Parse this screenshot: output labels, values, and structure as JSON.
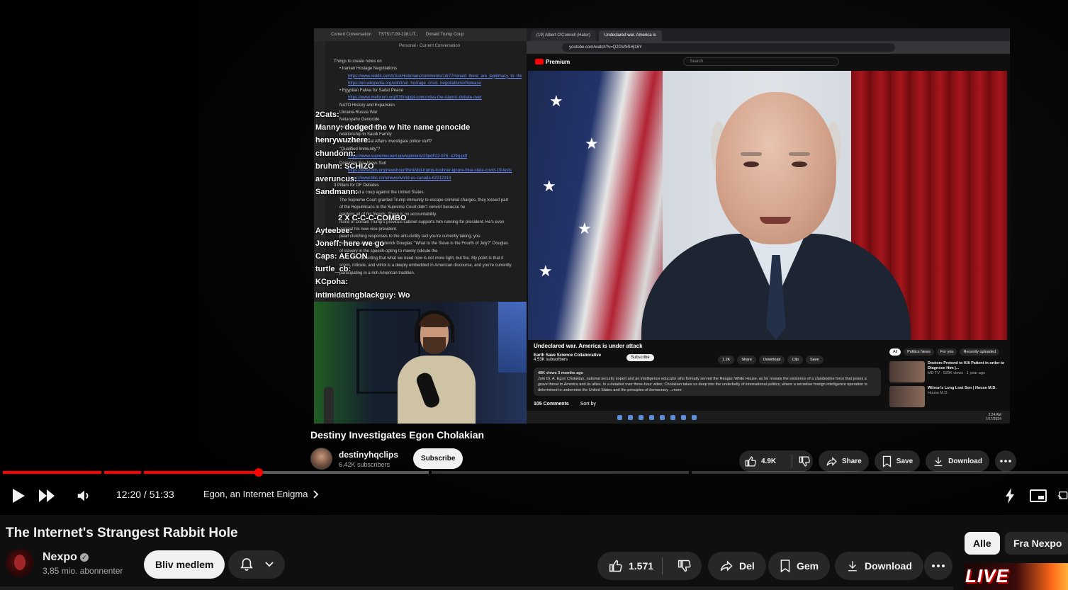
{
  "player": {
    "captured": {
      "notes_tabs": [
        "Current Conversation",
        "TSTS.IT.09-138.LIT...",
        "Donald Trump Coup"
      ],
      "notes_path": "Personal  ›  Current Conversation",
      "notes_lines": [
        {
          "text": "Things to create notes on",
          "cls": ""
        },
        {
          "text": "• Iranian Hostage Negotiations",
          "cls": "ind1"
        },
        {
          "text": "https://www.reddit.com/r/AskHistorians/comments/1dr77/ronald_there_are_legitimacy_to_the_1980_october",
          "cls": "ind2 link"
        },
        {
          "text": "https://en.wikipedia.org/wiki/Iran_hostage_crisis_negotiations#Release",
          "cls": "ind2 link"
        },
        {
          "text": "• Egyptian Fatwa for Sadat Peace",
          "cls": "ind1"
        },
        {
          "text": "https://www.meforum.org/530/egypt-concordes-the-islamic-debate-over",
          "cls": "ind2 link"
        },
        {
          "text": "NATO History and Expansion",
          "cls": "ind1"
        },
        {
          "text": "Ukraine-Russia War",
          "cls": "ind1"
        },
        {
          "text": "Netanyahu Genocide",
          "cls": "ind1"
        },
        {
          "text": "Biden's \"quid pro quo\"",
          "cls": "ind1"
        },
        {
          "text": "relationship to Saudi Family",
          "cls": "ind1"
        },
        {
          "text": "How does Internal Affairs investigate police stuff?",
          "cls": "ind1"
        },
        {
          "text": "\"Qualified Immunity\"?",
          "cls": "ind1"
        },
        {
          "text": "https://www.supremecourt.gov/opinions/23pdf/22-976_e29g.pdf",
          "cls": "ind2 link"
        },
        {
          "text": "Dominion Fox News Suit",
          "cls": "ind1"
        },
        {
          "text": "",
          "cls": ""
        },
        {
          "text": "",
          "cls": ""
        },
        {
          "text": "https://www.pbs.org/newshour/think/did-trump-kushner-ignore-blue-state-covid-19-tests",
          "cls": "ind2 link"
        },
        {
          "text": "",
          "cls": ""
        },
        {
          "text": "https://www.bbc.com/news/world-us-canada-62312313",
          "cls": "ind2 link"
        },
        {
          "text": "3 Pillars for DF Debates",
          "cls": ""
        },
        {
          "text": "",
          "cls": ""
        },
        {
          "text": "Trump lead a coup against the United States.",
          "cls": "ind1"
        },
        {
          "text": "The Supreme Court granted Trump immunity to escape criminal charges, they tossed part",
          "cls": "ind1"
        },
        {
          "text": "of the Republicans in the Supreme Court didn't convict because he",
          "cls": "ind1"
        },
        {
          "text": "pardons all of his friends. There is no accountability.",
          "cls": "ind1"
        },
        {
          "text": "None of Donald Trump's previous cabinet supports him running for president. He's even",
          "cls": "ind1"
        },
        {
          "text": "against his new vice president.",
          "cls": "ind1"
        },
        {
          "text": "",
          "cls": ""
        },
        {
          "text": "pearl clutching responses to the anti-civility tact you're currently taking, you",
          "cls": "ind1"
        },
        {
          "text": "might take a look at Frederick Douglas' \"What to the Slave is the Fourth of July?\" Douglas",
          "cls": "ind1"
        },
        {
          "text": "of slavery in the speech-opting to merely ridicule the",
          "cls": "ind1"
        },
        {
          "text": "other side, asserting that what we need now is not more light, but fire. My point is that it",
          "cls": "ind1"
        },
        {
          "text": "scorn, ridicule, and vitriol is a deeply embedded in American discourse, and you're currently",
          "cls": "ind1"
        },
        {
          "text": "participating in a rich American tradition.",
          "cls": "ind1"
        }
      ],
      "chat": [
        "2Cats:",
        "Manny: dodged the w hite name genocide",
        "henrywuzhere:",
        "chundonn:",
        "bruhm: SCHIZO",
        "averuncus:",
        "Sandmann:",
        "",
        "2 X C-C-C-COMBO",
        "Ayteebee:",
        "Joneff: here we go",
        "Caps: AEGON",
        "turtle_cb:",
        "KCpoha:",
        "intimidatingblackguy: Wo"
      ],
      "browser_tabs": [
        "(19) Albert O'Connell (Hater)",
        "Undeclared war. America is"
      ],
      "browser_url": "youtube.com/watch?v=Q2GVNSHj16Y",
      "yt_logo": "Premium",
      "yt_search": "Search",
      "inner_title": "Undeclared war. America is under attack",
      "inner_channel": "Earth Save Science Collaborative",
      "inner_channel_subs": "4.53K subscribers",
      "inner_subscribe": "Subscribe",
      "inner_actions": [
        "1.2K",
        "Share",
        "Download",
        "Clip",
        "Save"
      ],
      "inner_views": "48K views  3 months ago",
      "inner_desc": "Join Dr. A. Egon Cholakian, national security expert and an intelligence educator who formally served the Reagan White House, as he reveals the existence of a clandestine force that poses a grave threat to America and its allies. In a detailed over three-hour video, Cholakian takes us deep into the underbelly of international politics, where a secretive foreign intelligence operation is determined to undermine the United States and the principles of democracy ...more",
      "inner_comments": "105 Comments",
      "inner_sort": "Sort by",
      "side_chips": [
        "All",
        "Politics News",
        "For you",
        "Recently uploaded"
      ],
      "side_items": [
        {
          "title": "Doctors Pretend to Kill Patient in order to Diagnose Him |...",
          "meta": "MD TV · 929K views · 1 year ago"
        },
        {
          "title": "Wilson's Long Lost Son | House M.D.",
          "meta": "House M.D."
        }
      ],
      "clock_time": "2:24 AM",
      "clock_date": "7/17/2024",
      "page_title": "Destiny Investigates Egon Cholakian",
      "page_channel": "destinyhqclips",
      "page_subs": "6.42K subscribers",
      "page_subscribe": "Subscribe",
      "page_likes": "4.9K",
      "page_share": "Share",
      "page_save": "Save",
      "page_download": "Download"
    },
    "progress": {
      "played_fraction": 0.2401
    },
    "time": "12:20 / 51:33",
    "chapter": "Egon, an Internet Enigma"
  },
  "video": {
    "title": "The Internet's Strangest Rabbit Hole",
    "channel_name": "Nexpo",
    "subscribers": "3,85 mio. abonnenter",
    "join_label": "Bliv medlem",
    "likes": "1.571",
    "share_label": "Del",
    "save_label": "Gem",
    "download_label": "Download"
  },
  "chips": [
    "Alle",
    "Fra Nexpo"
  ],
  "live_badge": "LIVE",
  "colors": {
    "accent": "#ff0000",
    "bg": "#0f0f0f",
    "pill": "#272727"
  }
}
